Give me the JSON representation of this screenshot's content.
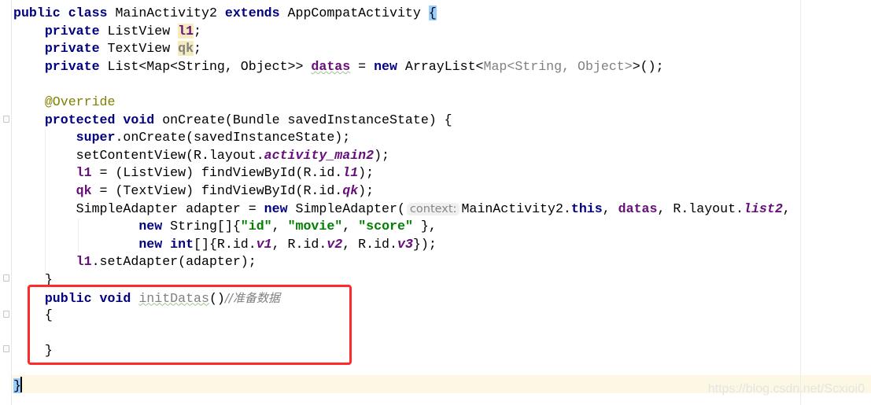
{
  "editor": {
    "lines": [
      [
        [
          "public class ",
          "kw"
        ],
        [
          "MainActivity2 ",
          ""
        ],
        [
          "extends ",
          "kw"
        ],
        [
          "AppCompatActivity ",
          ""
        ],
        [
          "{",
          "brace-hl"
        ]
      ],
      [
        [
          "    private ",
          "kw"
        ],
        [
          "ListView ",
          ""
        ],
        [
          "l1",
          "fld hl"
        ],
        [
          ";",
          ""
        ]
      ],
      [
        [
          "    private ",
          "kw"
        ],
        [
          "TextView ",
          ""
        ],
        [
          "qk",
          "fld hl gray"
        ],
        [
          ";",
          ""
        ]
      ],
      [
        [
          "    private ",
          "kw"
        ],
        [
          "List<Map<String, Object>> ",
          ""
        ],
        [
          "datas",
          "fld squig"
        ],
        [
          " = ",
          ""
        ],
        [
          "new ",
          "kw"
        ],
        [
          "ArrayList<",
          ""
        ],
        [
          "Map<String, Object>",
          "gray"
        ],
        [
          ">();",
          ""
        ]
      ],
      [],
      [
        [
          "    @Override",
          "ann"
        ]
      ],
      [
        [
          "    protected void ",
          "kw"
        ],
        [
          "onCreate(Bundle savedInstanceState) {",
          ""
        ]
      ],
      [
        [
          "        super",
          "kw"
        ],
        [
          ".onCreate(savedInstanceState);",
          ""
        ]
      ],
      [
        [
          "        setContentView(R.layout.",
          ""
        ],
        [
          "activity_main2",
          "sfld"
        ],
        [
          ");",
          ""
        ]
      ],
      [
        [
          "        ",
          ""
        ],
        [
          "l1",
          "fld"
        ],
        [
          " = (ListView) findViewById(R.id.",
          ""
        ],
        [
          "l1",
          "sfld"
        ],
        [
          ");",
          ""
        ]
      ],
      [
        [
          "        ",
          ""
        ],
        [
          "qk",
          "fld"
        ],
        [
          " = (TextView) findViewById(R.id.",
          ""
        ],
        [
          "qk",
          "sfld"
        ],
        [
          ");",
          ""
        ]
      ],
      [
        [
          "        SimpleAdapter adapter = ",
          ""
        ],
        [
          "new ",
          "kw"
        ],
        [
          "SimpleAdapter(",
          ""
        ],
        [
          "context:",
          "hint"
        ],
        [
          "MainActivity2.",
          ""
        ],
        [
          "this",
          "kw"
        ],
        [
          ", ",
          ""
        ],
        [
          "datas",
          "fld"
        ],
        [
          ", R.layout.",
          ""
        ],
        [
          "list2",
          "sfld"
        ],
        [
          ",",
          ""
        ]
      ],
      [
        [
          "                new ",
          "kw"
        ],
        [
          "String[]{",
          ""
        ],
        [
          "\"id\"",
          "str"
        ],
        [
          ", ",
          ""
        ],
        [
          "\"movie\"",
          "str"
        ],
        [
          ", ",
          ""
        ],
        [
          "\"score\"",
          "str"
        ],
        [
          " },",
          ""
        ]
      ],
      [
        [
          "                new int",
          "kw"
        ],
        [
          "[]{R.id.",
          ""
        ],
        [
          "v1",
          "sfld"
        ],
        [
          ", R.id.",
          ""
        ],
        [
          "v2",
          "sfld"
        ],
        [
          ", R.id.",
          ""
        ],
        [
          "v3",
          "sfld"
        ],
        [
          "});",
          ""
        ]
      ],
      [
        [
          "        ",
          ""
        ],
        [
          "l1",
          "fld"
        ],
        [
          ".setAdapter(adapter);",
          ""
        ]
      ],
      [
        [
          "    }",
          ""
        ]
      ],
      [
        [
          "    public void ",
          "kw"
        ],
        [
          "initDatas",
          "gray squig"
        ],
        [
          "()",
          ""
        ],
        [
          "//准备数据",
          "cmt"
        ]
      ],
      [
        [
          "    {",
          ""
        ]
      ],
      [],
      [
        [
          "    }",
          ""
        ]
      ],
      [],
      [
        [
          "}",
          "brace-hl"
        ]
      ]
    ]
  },
  "watermark": "https://blog.csdn.net/Scxioi0",
  "colors": {
    "keyword": "#000080",
    "field": "#660e7a",
    "string": "#008000",
    "annotation": "#808000",
    "highlight_box": "#ff2a2a"
  }
}
